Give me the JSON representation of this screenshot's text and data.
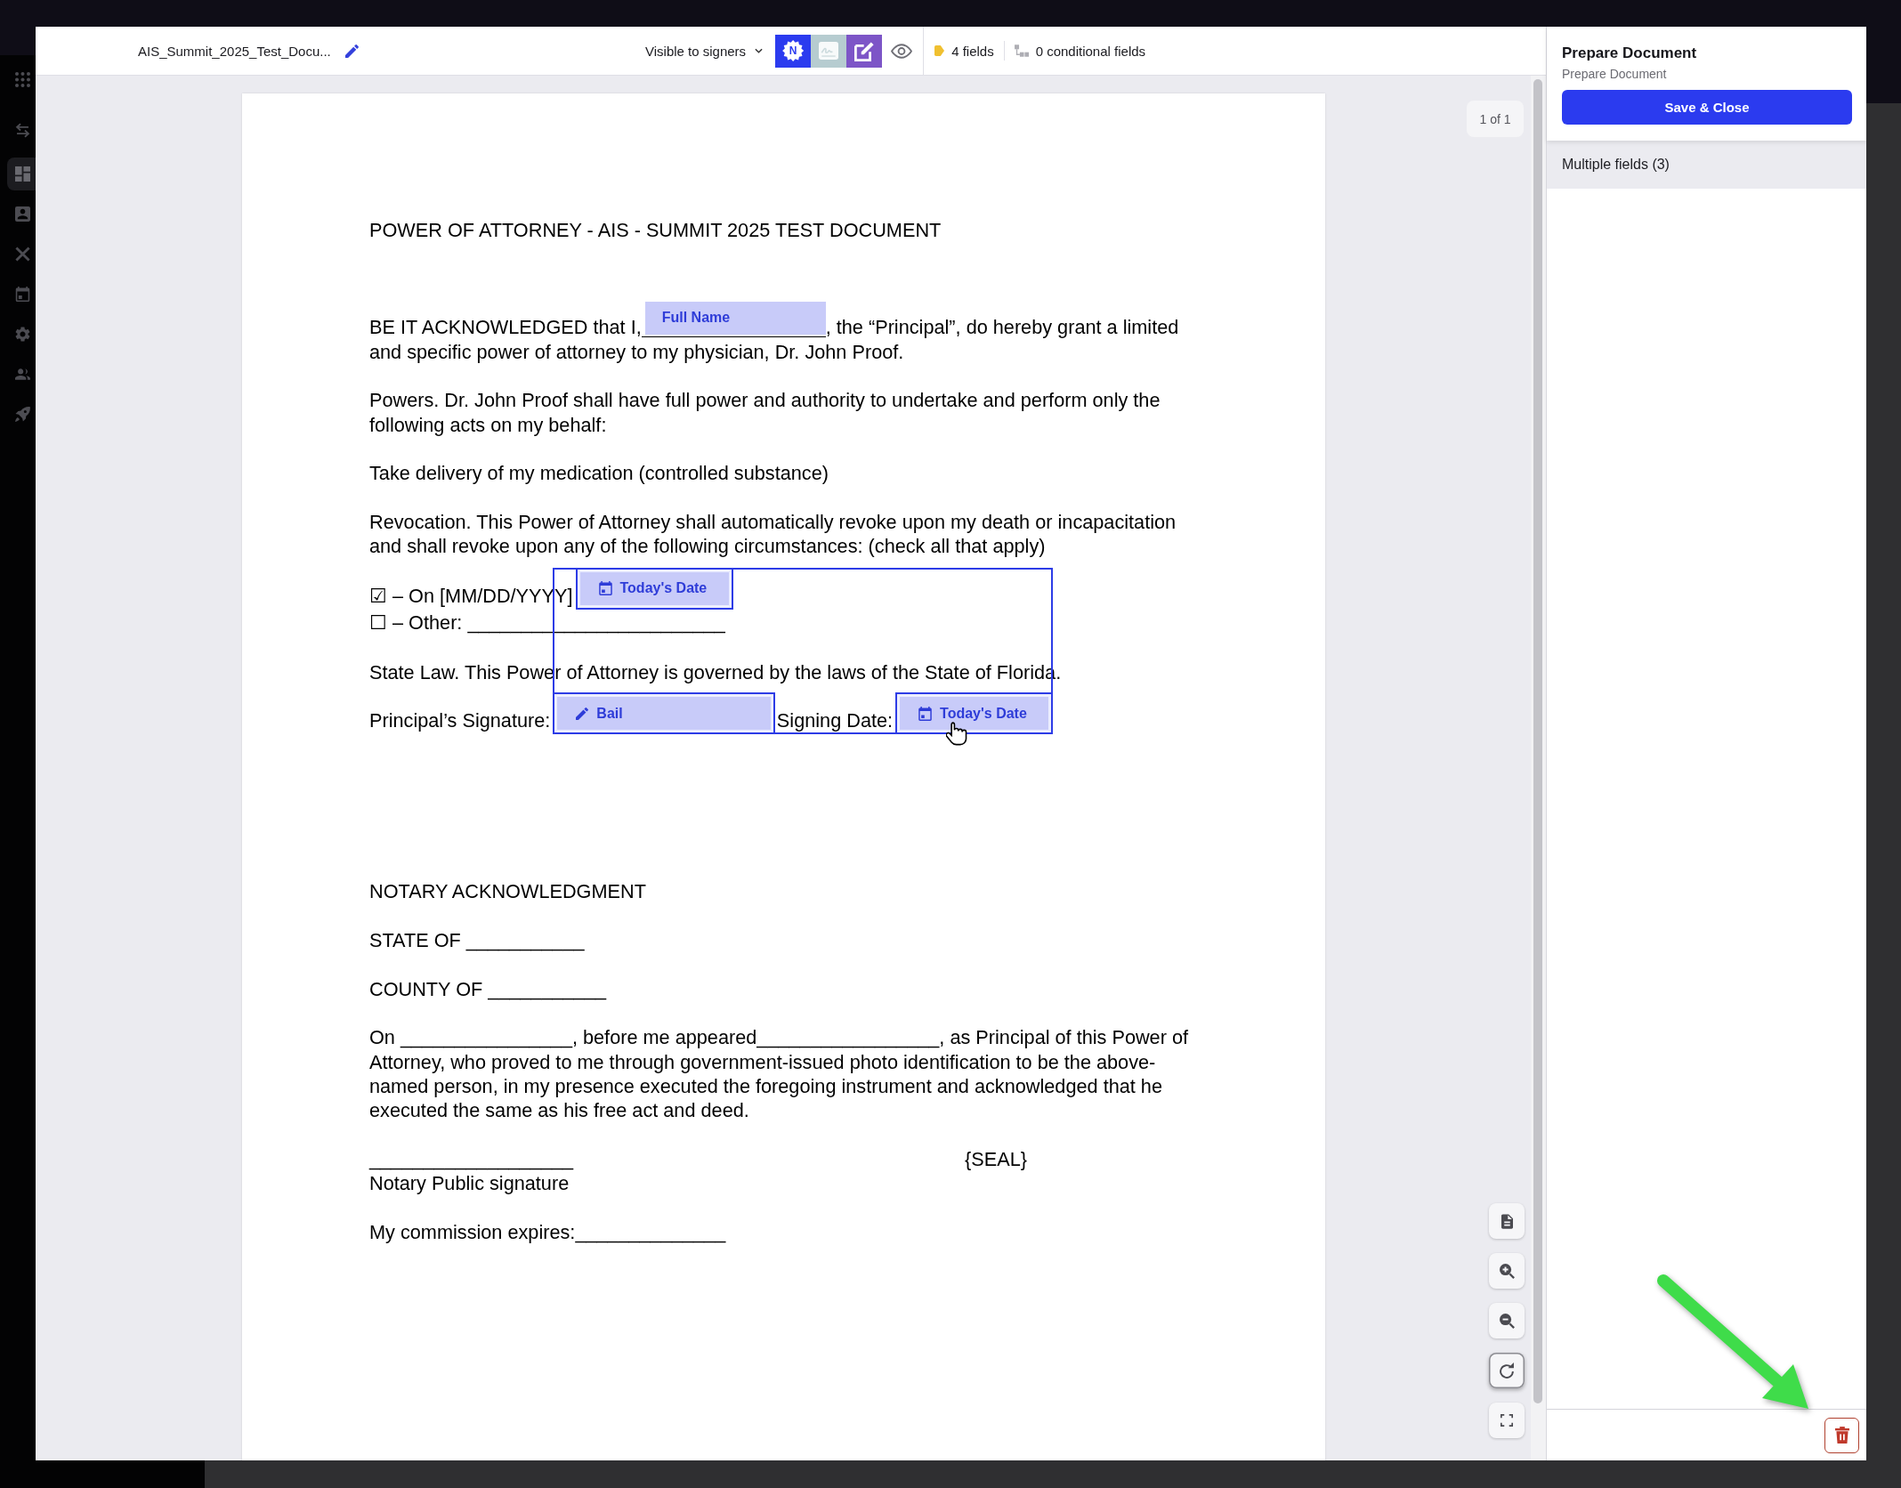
{
  "sidebar": {
    "items": [
      {
        "kind": "apps",
        "selected": false
      },
      {
        "kind": "transfer",
        "selected": false
      },
      {
        "kind": "dashboard",
        "selected": true
      },
      {
        "kind": "contacts",
        "selected": false
      },
      {
        "kind": "tools",
        "selected": false
      },
      {
        "kind": "calendar",
        "selected": false
      },
      {
        "kind": "settings",
        "selected": false
      },
      {
        "kind": "people",
        "selected": false
      },
      {
        "kind": "launch",
        "selected": false
      }
    ]
  },
  "header": {
    "filename": "AIS_Summit_2025_Test_Docu...",
    "visibility": "Visible to signers",
    "tools": [
      {
        "kind": "badge",
        "label": "N",
        "disabled": false
      },
      {
        "kind": "signature",
        "disabled": true
      },
      {
        "kind": "edit",
        "disabled": false
      }
    ],
    "field_count": "4 fields",
    "conditional_count": "0 conditional fields"
  },
  "viewer": {
    "page_indicator": "1 of 1",
    "tools": [
      {
        "kind": "page",
        "focused": false
      },
      {
        "kind": "zoom_in",
        "focused": false
      },
      {
        "kind": "zoom_out",
        "focused": false
      },
      {
        "kind": "rotate",
        "focused": true
      },
      {
        "kind": "fullscreen",
        "focused": false
      }
    ]
  },
  "document": {
    "title": "POWER OF ATTORNEY - AIS - SUMMIT 2025 TEST DOCUMENT",
    "sections": [
      {
        "paragraphs": [
          {
            "kind": "form",
            "lines": [
              [
                {
                  "kind": "text",
                  "text": "BE IT ACKNOWLEDGED that I,"
                },
                {
                  "kind": "text_field",
                  "label": "Full Name",
                  "selected": false,
                  "underlined": true
                },
                {
                  "kind": "text",
                  "text": ", the “Principal”, do hereby grant a limited"
                }
              ],
              [
                {
                  "kind": "text",
                  "text": "and specific power of attorney to my physician, Dr. John Proof."
                }
              ]
            ]
          },
          {
            "kind": "text",
            "lines": [
              "Powers. Dr. John Proof shall have full power and authority to undertake and perform only the",
              "following acts on my behalf:"
            ]
          },
          {
            "kind": "text",
            "lines": [
              "Take delivery of my medication (controlled substance)"
            ]
          },
          {
            "kind": "text",
            "lines": [
              "Revocation. This Power of Attorney shall automatically revoke upon my death or incapacitation",
              "and shall revoke upon any of the following circumstances: (check all that apply)"
            ]
          },
          {
            "kind": "checklist",
            "lines": [
              [
                {
                  "kind": "text",
                  "text": "☑ – On [MM/DD/YYYY]"
                },
                {
                  "kind": "date_field",
                  "label": "Today's Date",
                  "selected": true,
                  "underlined": false
                }
              ],
              [
                {
                  "kind": "text",
                  "text": "☐ – Other: ________________________"
                }
              ]
            ]
          },
          {
            "kind": "text",
            "lines": [
              "State Law. This Power of Attorney is governed by the laws of the State of Florida."
            ]
          },
          {
            "kind": "form",
            "lines": [
              [
                {
                  "kind": "text",
                  "text": "Principal’s Signature:"
                },
                {
                  "kind": "signature_field",
                  "label": "Bail",
                  "selected": true,
                  "underlined": false
                },
                {
                  "kind": "text",
                  "text": "Signing Date:"
                },
                {
                  "kind": "date_field",
                  "label": "Today's Date",
                  "selected": true,
                  "underlined": false
                }
              ]
            ]
          }
        ]
      },
      {
        "paragraphs": [
          {
            "kind": "text",
            "lines": [
              "NOTARY ACKNOWLEDGMENT"
            ]
          },
          {
            "kind": "text",
            "lines": [
              "STATE OF ___________"
            ]
          },
          {
            "kind": "text",
            "lines": [
              "COUNTY OF ___________"
            ]
          },
          {
            "kind": "text",
            "lines": [
              "On ________________, before me appeared_________________, as Principal of this Power of",
              "Attorney, who proved to me through government-issued photo identification to be the above-",
              "named person, in my presence executed the foregoing instrument and acknowledged that he",
              "executed the same as his free act and deed."
            ]
          },
          {
            "kind": "signature_block",
            "line": "___________________",
            "seal": "{SEAL}",
            "caption": "Notary Public signature"
          },
          {
            "kind": "text",
            "lines": [
              "My commission expires:______________"
            ]
          }
        ]
      }
    ]
  },
  "panel": {
    "title": "Prepare Document",
    "subtitle": "Prepare Document",
    "save_button": "Save & Close",
    "selection": "Multiple fields (3)"
  }
}
